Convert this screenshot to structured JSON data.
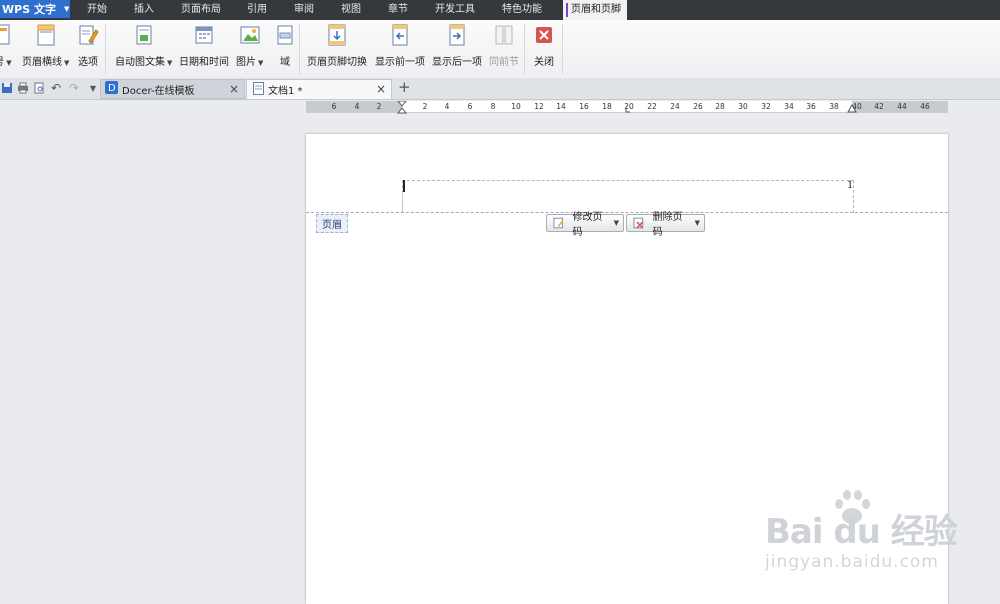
{
  "app": {
    "name": "WPS 文字"
  },
  "menu": {
    "tabs": [
      "开始",
      "插入",
      "页面布局",
      "引用",
      "审阅",
      "视图",
      "章节",
      "开发工具",
      "特色功能",
      "页眉和页脚"
    ],
    "active_tab": "页眉和页脚"
  },
  "ribbon": {
    "partial_label": "号",
    "header_line": "页眉横线",
    "options": "选项",
    "autotext": "自动图文集",
    "datetime": "日期和时间",
    "picture": "图片",
    "field": "域",
    "switch": "页眉页脚切换",
    "show_prev": "显示前一项",
    "show_next": "显示后一项",
    "same_as_prev": "同前节",
    "close": "关闭"
  },
  "tabs": {
    "docer": "Docer-在线模板",
    "doc1": "文档1 *"
  },
  "ruler": {
    "ticks": [
      "6",
      "4",
      "2",
      "2",
      "4",
      "6",
      "8",
      "10",
      "12",
      "14",
      "16",
      "18",
      "20",
      "22",
      "24",
      "26",
      "28",
      "30",
      "32",
      "34",
      "36",
      "38",
      "40",
      "42",
      "44",
      "46"
    ]
  },
  "page": {
    "page_number": "1",
    "header_label": "页眉",
    "modify_page_number": "修改页码",
    "delete_page_number": "删除页码"
  },
  "watermark": {
    "logo": "Bai du 经验",
    "url": "jingyan.baidu.com"
  },
  "colors": {
    "menubar": "#35383d",
    "app_button": "#2f6fd0",
    "active_tab_marker": "#8a3fc7",
    "close_red": "#d9534f"
  }
}
